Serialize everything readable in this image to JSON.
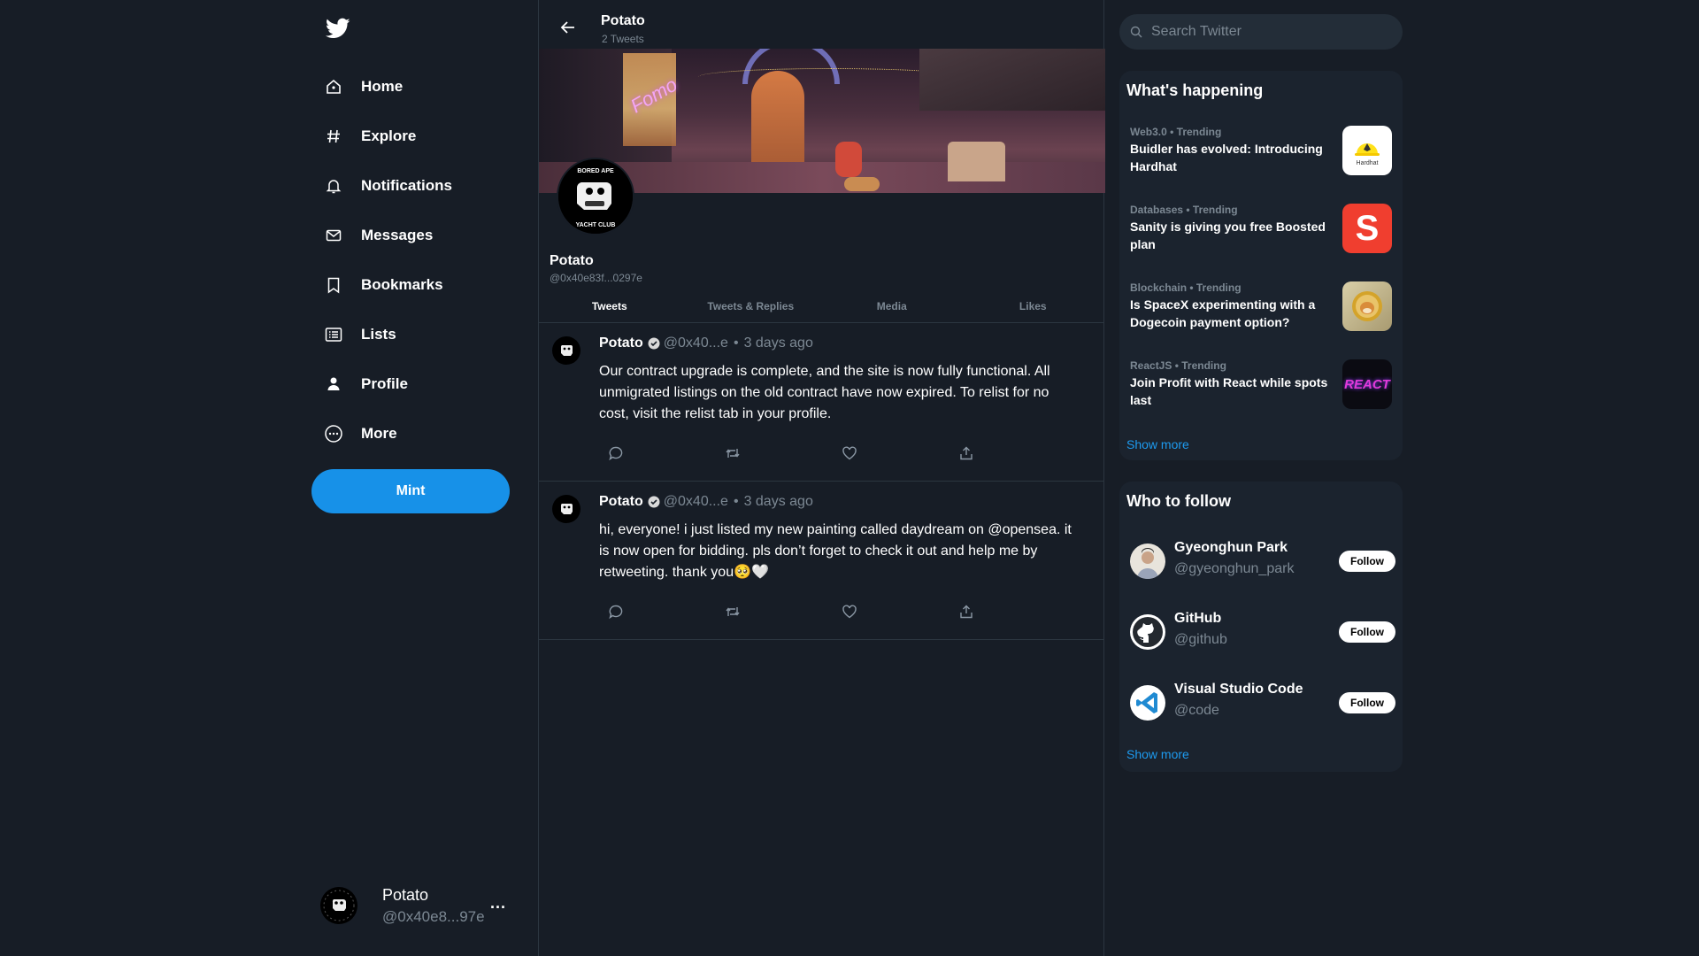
{
  "sidebar": {
    "logo": "twitter-bird-icon",
    "items": [
      {
        "label": "Home",
        "icon": "home-icon"
      },
      {
        "label": "Explore",
        "icon": "hashtag-icon"
      },
      {
        "label": "Notifications",
        "icon": "bell-icon"
      },
      {
        "label": "Messages",
        "icon": "envelope-icon"
      },
      {
        "label": "Bookmarks",
        "icon": "bookmark-icon"
      },
      {
        "label": "Lists",
        "icon": "list-icon"
      },
      {
        "label": "Profile",
        "icon": "person-icon"
      },
      {
        "label": "More",
        "icon": "more-circle-icon"
      }
    ],
    "mint_label": "Mint",
    "account": {
      "name": "Potato",
      "handle": "@0x40e8...97e",
      "menu": "..."
    }
  },
  "profile": {
    "header_name": "Potato",
    "tweet_count": "2 Tweets",
    "name": "Potato",
    "handle": "@0x40e83f...0297e",
    "banner_sign": "Fomo",
    "tabs": [
      {
        "label": "Tweets",
        "active": true
      },
      {
        "label": "Tweets & Replies",
        "active": false
      },
      {
        "label": "Media",
        "active": false
      },
      {
        "label": "Likes",
        "active": false
      }
    ]
  },
  "tweets": [
    {
      "name": "Potato",
      "handle": "@0x40...e",
      "separator": "•",
      "time": "3 days ago",
      "text": "Our contract upgrade is complete, and the site is now fully functional. All unmigrated listings on the old contract have now expired. To relist for no cost, visit the relist tab in your profile."
    },
    {
      "name": "Potato",
      "handle": "@0x40...e",
      "separator": "•",
      "time": "3 days ago",
      "text": "hi, everyone! i just listed my new painting called daydream on @opensea. it is now open for bidding. pls don’t forget to check it out and help me by retweeting. thank you🥺🤍"
    }
  ],
  "search": {
    "placeholder": "Search Twitter"
  },
  "happening": {
    "title": "What's happening",
    "items": [
      {
        "meta": "Web3.0 • Trending",
        "title": "Buidler has evolved: Introducing Hardhat",
        "thumb_label": "Hardhat"
      },
      {
        "meta": "Databases • Trending",
        "title": "Sanity is giving you free Boosted plan",
        "thumb_label": "S"
      },
      {
        "meta": "Blockchain • Trending",
        "title": "Is SpaceX experimenting with a Dogecoin payment option?",
        "thumb_label": ""
      },
      {
        "meta": "ReactJS • Trending",
        "title": "Join Profit with React while spots last",
        "thumb_label": "REACT"
      }
    ],
    "show_more": "Show more"
  },
  "who_to_follow": {
    "title": "Who to follow",
    "items": [
      {
        "name": "Gyeonghun Park",
        "handle": "@gyeonghun_park",
        "button": "Follow"
      },
      {
        "name": "GitHub",
        "handle": "@github",
        "button": "Follow"
      },
      {
        "name": "Visual Studio Code",
        "handle": "@code",
        "button": "Follow"
      }
    ],
    "show_more": "Show more"
  },
  "colors": {
    "accent": "#1791e8",
    "background": "#171d26",
    "panel": "#1b232e",
    "muted": "#7c8893",
    "link": "#1d9bf0"
  }
}
